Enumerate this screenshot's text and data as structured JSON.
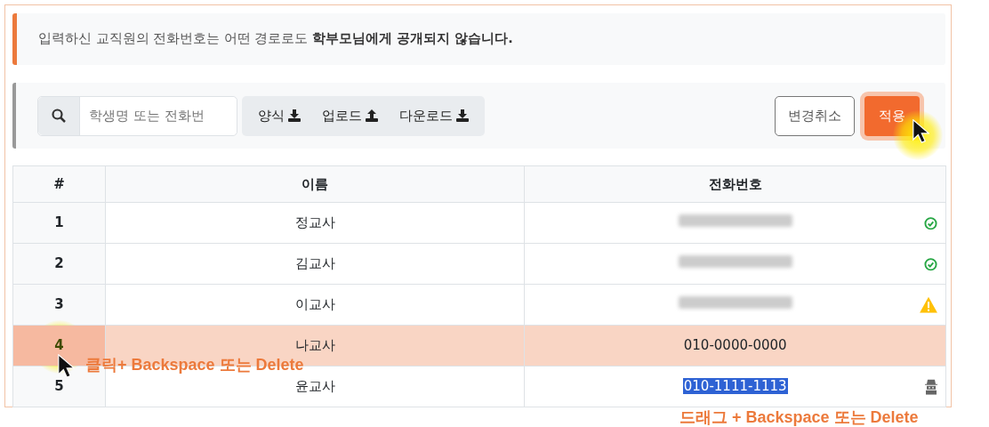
{
  "notice": {
    "text": "입력하신 교직원의 전화번호는 어떤 경로로도 **학부모님에게 공개되지 않습니다.**"
  },
  "toolbar": {
    "search": {
      "placeholder": "학생명 또는 전화번"
    },
    "file_buttons": [
      {
        "label": "양식",
        "kind": "download"
      },
      {
        "label": "업로드",
        "kind": "upload"
      },
      {
        "label": "다운로드",
        "kind": "download"
      }
    ],
    "cancel_button": "변경취소",
    "apply_button": {
      "label": "적용",
      "clicked": true
    }
  },
  "table": {
    "columns": [
      "#",
      "이름",
      "전화번호"
    ],
    "rows": [
      {
        "index": "1",
        "name": "정교사",
        "phone_blurred": true,
        "kind": "ok",
        "selected": false
      },
      {
        "index": "2",
        "name": "김교사",
        "phone_blurred": true,
        "kind": "ok",
        "selected": false
      },
      {
        "index": "3",
        "name": "이교사",
        "phone_blurred": true,
        "kind": "warning",
        "selected": false
      },
      {
        "index": "4",
        "name": "나교사",
        "phone": "010-0000-0000",
        "kind": "plain",
        "selected": true,
        "clicked": true
      },
      {
        "index": "5",
        "name": "윤교사",
        "phone": "010-1111-1113",
        "phone_highlighted": true,
        "kind": "hidden",
        "selected": false
      }
    ]
  },
  "annotations": [
    {
      "text": "클릭+ Backspace 또는 Delete",
      "kind": "row"
    },
    {
      "text": "드래그 + Backspace 또는 Delete",
      "kind": "cell"
    }
  ]
}
